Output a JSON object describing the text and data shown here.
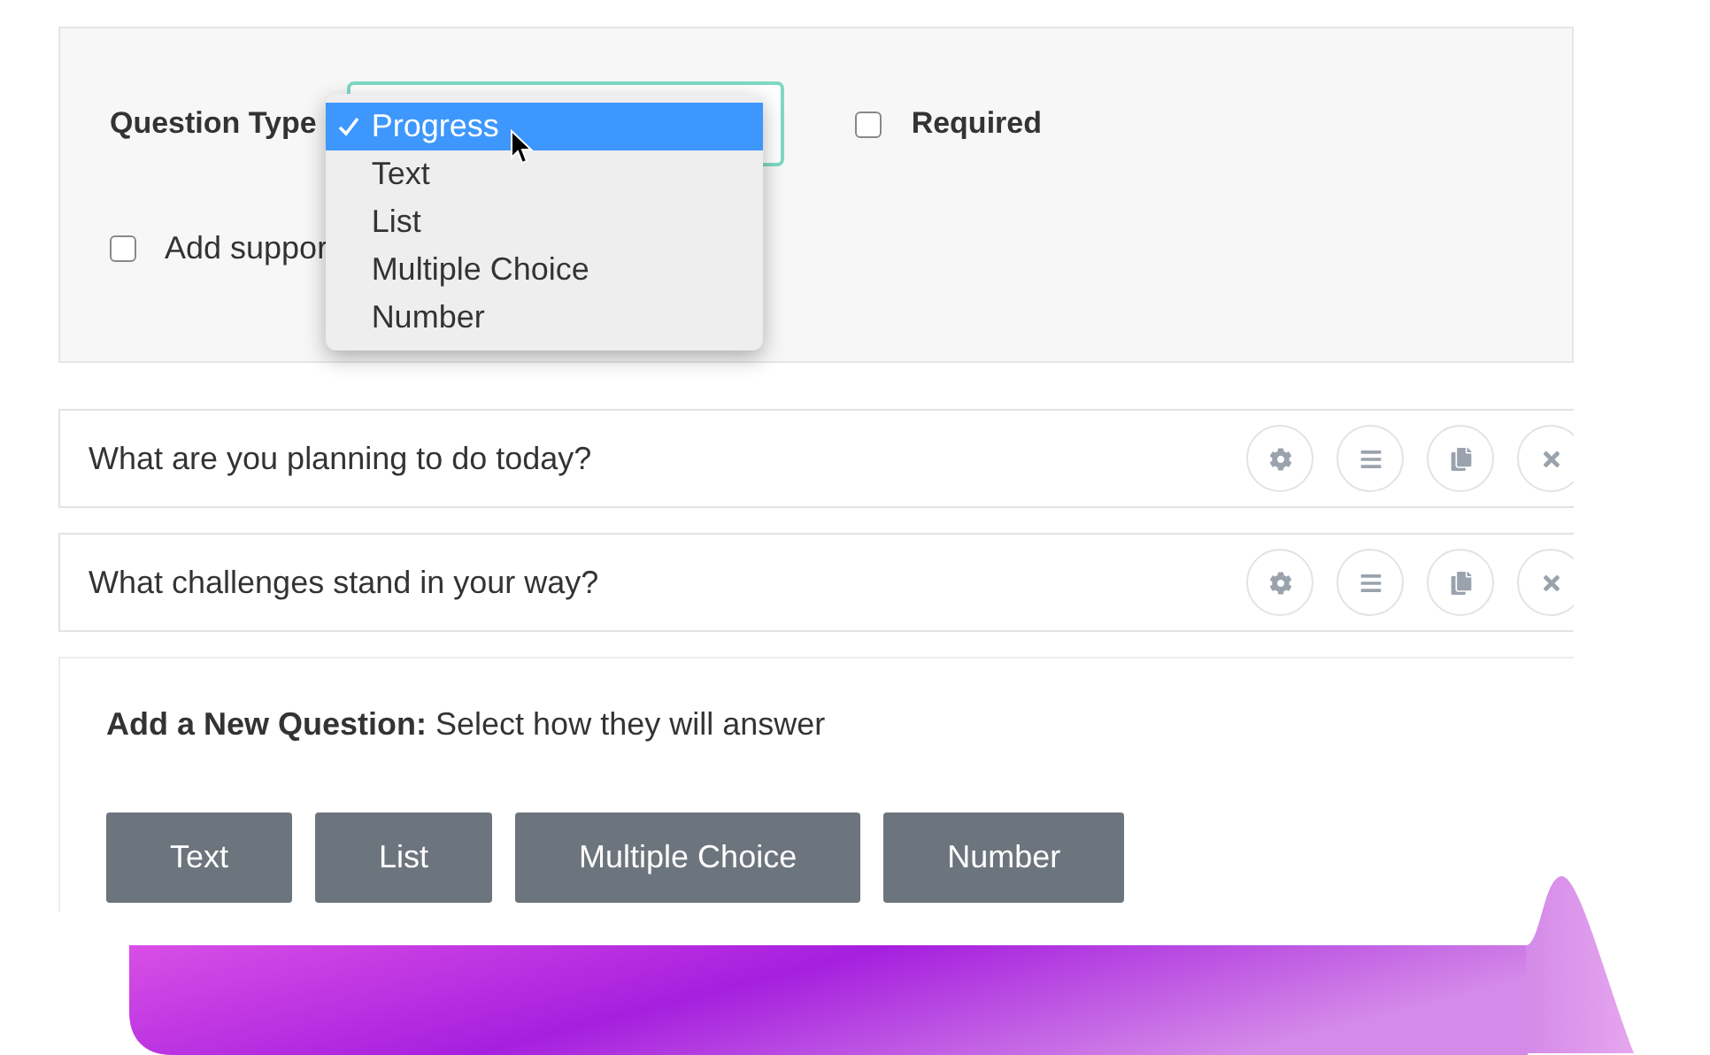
{
  "question_settings": {
    "label": "Question Type",
    "options": [
      {
        "label": "Progress",
        "selected": true
      },
      {
        "label": "Text",
        "selected": false
      },
      {
        "label": "List",
        "selected": false
      },
      {
        "label": "Multiple Choice",
        "selected": false
      },
      {
        "label": "Number",
        "selected": false
      }
    ],
    "required": {
      "label": "Required",
      "checked": false
    },
    "support": {
      "label": "Add suppor",
      "checked": false
    }
  },
  "questions": [
    {
      "text": "What are you planning to do today?"
    },
    {
      "text": "What challenges stand in your way?"
    }
  ],
  "add_question": {
    "title": "**Add a New Question:** Select how they will answer",
    "buttons": [
      "Text",
      "List",
      "Multiple Choice",
      "Number"
    ]
  }
}
